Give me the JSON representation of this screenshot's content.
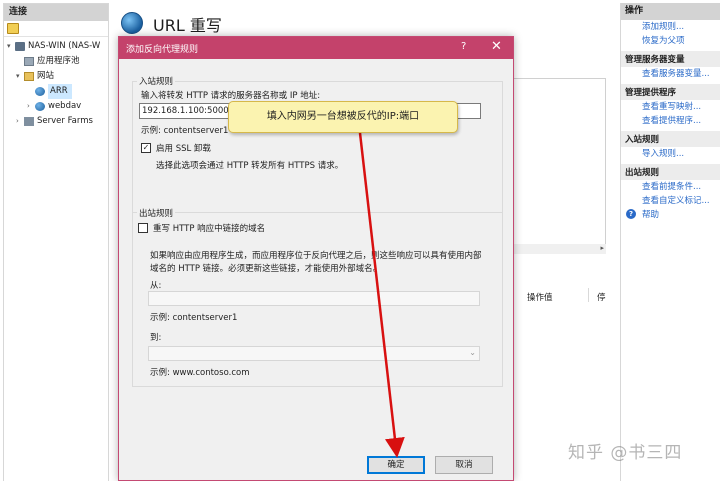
{
  "left_pane": {
    "header": "连接",
    "tree": [
      {
        "label": "NAS-WIN (NAS-W",
        "expander": "▾",
        "icon": "server-icon"
      },
      {
        "label": "应用程序池",
        "expander": "",
        "icon": "app-pool-icon"
      },
      {
        "label": "网站",
        "expander": "▾",
        "icon": "sites-folder-icon"
      },
      {
        "label": "ARR",
        "expander": "",
        "icon": "globe-icon",
        "selected": true
      },
      {
        "label": "webdav",
        "expander": "›",
        "icon": "globe-icon"
      },
      {
        "label": "Server Farms",
        "expander": "›",
        "icon": "server-farms-icon"
      }
    ]
  },
  "main": {
    "title": "URL 重写",
    "columns": {
      "col1": "操作值",
      "col2": "停"
    }
  },
  "right_pane": {
    "header": "操作",
    "items": [
      {
        "type": "link",
        "label": "添加规则..."
      },
      {
        "type": "link",
        "label": "恢复为父项"
      },
      {
        "type": "group",
        "label": "管理服务器变量"
      },
      {
        "type": "link",
        "label": "查看服务器变量..."
      },
      {
        "type": "group",
        "label": "管理提供程序"
      },
      {
        "type": "link",
        "label": "查看重写映射..."
      },
      {
        "type": "link",
        "label": "查看提供程序..."
      },
      {
        "type": "group",
        "label": "入站规则"
      },
      {
        "type": "link",
        "label": "导入规则..."
      },
      {
        "type": "group",
        "label": "出站规则"
      },
      {
        "type": "link",
        "label": "查看前提条件..."
      },
      {
        "type": "link",
        "label": "查看自定义标记..."
      }
    ],
    "help": "帮助"
  },
  "dialog": {
    "title": "添加反向代理规则",
    "help_button": "?",
    "close_button": "✕",
    "inbound": {
      "group_label": "入站规则",
      "server_prompt": "输入将转发 HTTP 请求的服务器名称或 IP 地址:",
      "server_value": "192.168.1.100:5000",
      "server_example": "示例: contentserver1",
      "ssl_checked": true,
      "ssl_label": "启用 SSL 卸载",
      "ssl_description": "选择此选项会通过 HTTP 转发所有 HTTPS 请求。"
    },
    "outbound": {
      "group_label": "出站规则",
      "rewrite_checked": false,
      "rewrite_label": "重写 HTTP 响应中链接的域名",
      "description_line1": "如果响应由应用程序生成，而应用程序位于反向代理之后，则这些响应可以具有使用内部",
      "description_line2": "域名的 HTTP 链接。必须更新这些链接，才能使用外部域名。",
      "from_label": "从:",
      "from_value": "",
      "from_example": "示例: contentserver1",
      "to_label": "到:",
      "to_value": "",
      "to_example": "示例: www.contoso.com"
    },
    "ok_button": "确定",
    "cancel_button": "取消"
  },
  "annotation": {
    "text": "填入内网另一台想被反代的IP:端口",
    "arrow_color": "#d81010"
  },
  "watermark": "知乎 @书三四",
  "colors": {
    "dialog_titlebar": "#c4426b",
    "link": "#2a6ac8",
    "callout_bg": "#fbf3b0"
  }
}
